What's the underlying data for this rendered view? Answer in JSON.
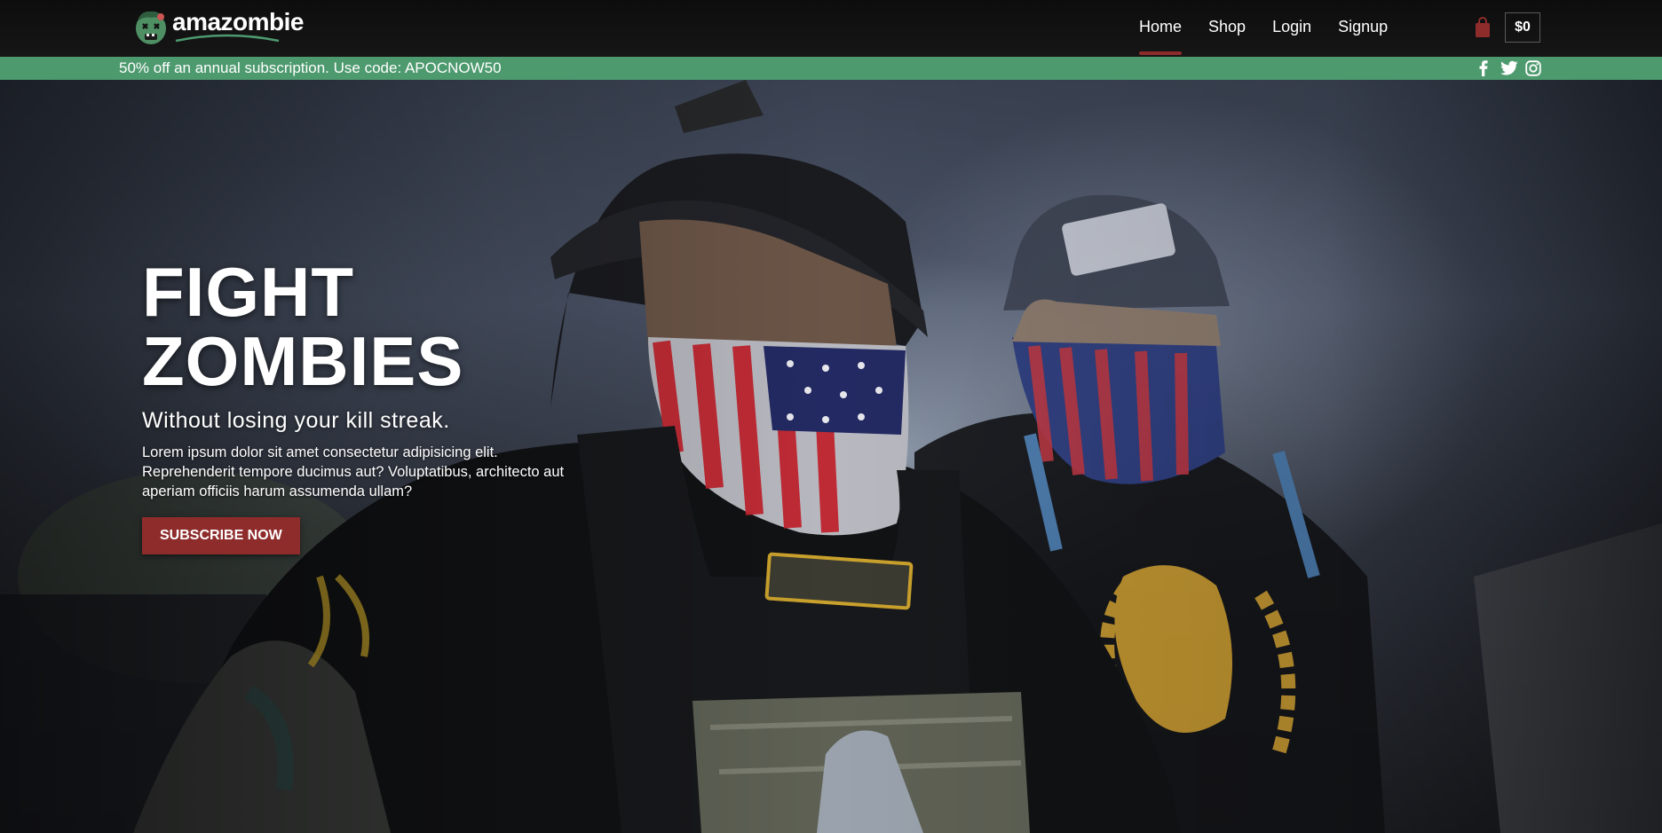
{
  "brand": {
    "name": "amazombie",
    "logo_icon": "zombie-face-icon"
  },
  "nav": {
    "items": [
      {
        "label": "Home",
        "active": true
      },
      {
        "label": "Shop",
        "active": false
      },
      {
        "label": "Login",
        "active": false
      },
      {
        "label": "Signup",
        "active": false
      }
    ],
    "cart_icon": "shopping-bag-icon",
    "cart_total": "$0"
  },
  "promo": {
    "text": "50% off an annual subscription. Use code: APOCNOW50",
    "social": [
      "facebook-icon",
      "twitter-icon",
      "instagram-icon"
    ]
  },
  "hero": {
    "title_line1": "FIGHT",
    "title_line2": "ZOMBIES",
    "subtitle": "Without losing your kill streak.",
    "body": "Lorem ipsum dolor sit amet consectetur adipisicing elit. Reprehenderit tempore ducimus aut? Voluptatibus, architecto aut aperiam officiis harum assumenda ullam?",
    "cta_label": "SUBSCRIBE NOW",
    "image": "photo of two men in caps wearing American flag face masks and tactical vests"
  },
  "colors": {
    "accent_red": "#8e2c2c",
    "promo_green": "#4e9a6f",
    "nav_bg": "#111111"
  }
}
